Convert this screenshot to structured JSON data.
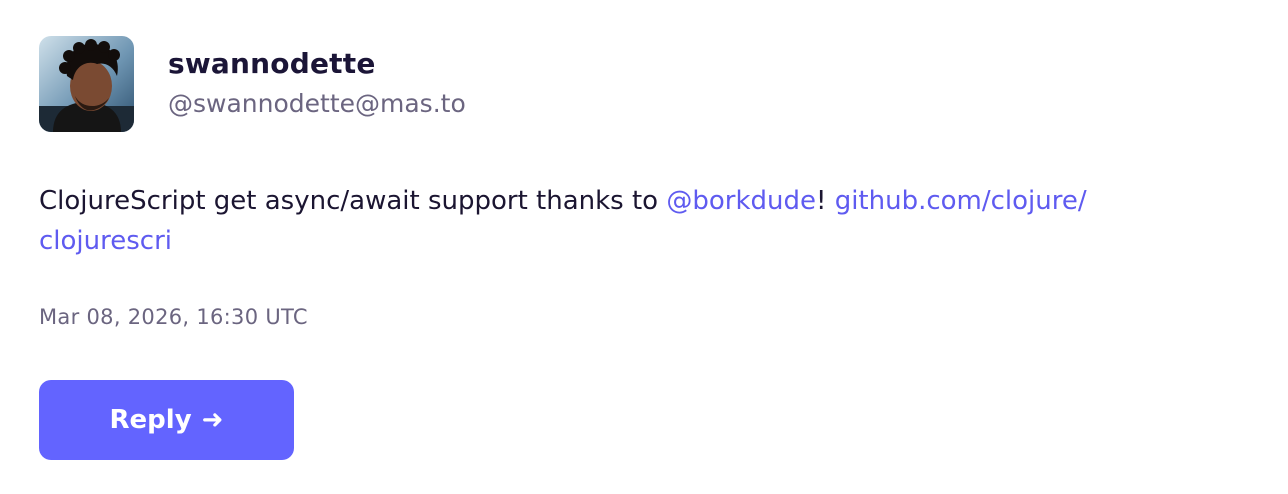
{
  "account": {
    "display_name": "swannodette",
    "handle": "@swannodette@mas.to"
  },
  "post": {
    "text_before_mention": "ClojureScript get async/await support thanks to ",
    "mention": "@borkdude",
    "text_after_mention": "!  ",
    "link_line1": "github.com/clojure/",
    "link_line2": "clojurescri",
    "timestamp": "Mar 08, 2026, 16:30 UTC"
  },
  "actions": {
    "reply_label": "Reply",
    "reply_icon": "➜"
  },
  "colors": {
    "accent": "#6364ff",
    "link": "#5f5bf0",
    "text": "#1b1531",
    "muted": "#6b6580"
  }
}
